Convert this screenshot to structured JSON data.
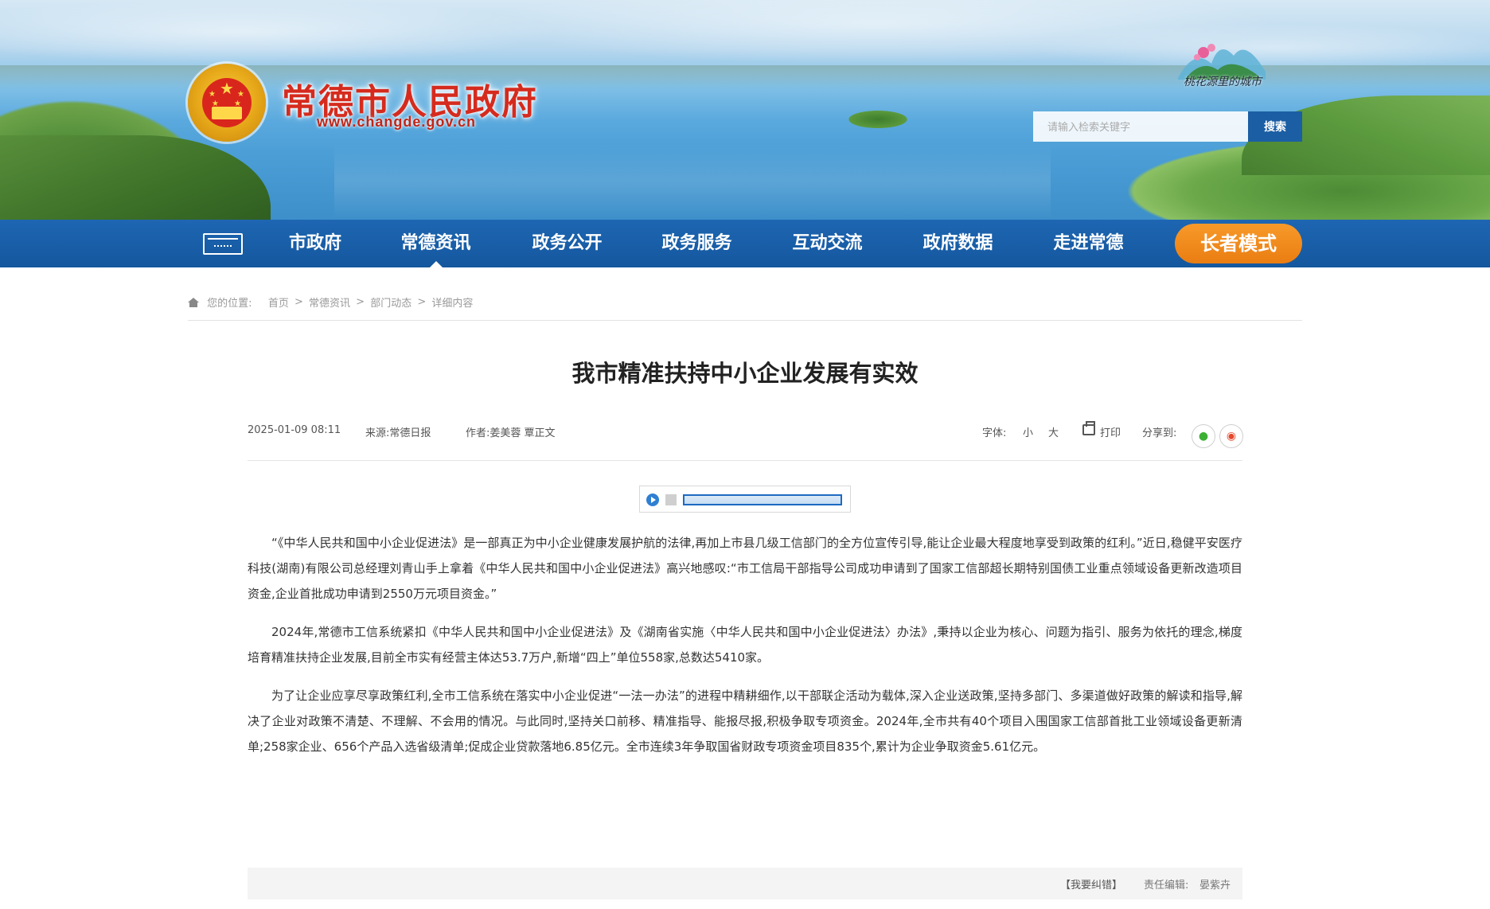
{
  "header": {
    "site_title": "常德市人民政府",
    "site_url": "www.changde.gov.cn",
    "city_slogan": "桃花源里的城市",
    "search": {
      "placeholder": "请输入检索关键字",
      "button_label": "搜索"
    }
  },
  "nav": {
    "items": [
      {
        "label": "市政府"
      },
      {
        "label": "常德资讯"
      },
      {
        "label": "政务公开"
      },
      {
        "label": "政务服务"
      },
      {
        "label": "互动交流"
      },
      {
        "label": "政府数据"
      },
      {
        "label": "走进常德"
      }
    ],
    "active_index": 1,
    "elder_mode_label": "长者模式"
  },
  "breadcrumb": {
    "prefix": "您的位置:",
    "items": [
      "首页",
      "常德资讯",
      "部门动态",
      "详细内容"
    ],
    "separator": ">"
  },
  "article": {
    "title": "我市精准扶持中小企业发展有实效",
    "date": "2025-01-09 08:11",
    "source": "来源:常德日报",
    "author": "作者:姜美蓉 覃正文",
    "font_label": "字体:",
    "font_small": "小",
    "font_large": "大",
    "print_label": "打印",
    "share_label": "分享到:",
    "paragraphs": [
      "“《中华人民共和国中小企业促进法》是一部真正为中小企业健康发展护航的法律,再加上市县几级工信部门的全方位宣传引导,能让企业最大程度地享受到政策的红利。”近日,稳健平安医疗科技(湖南)有限公司总经理刘青山手上拿着《中华人民共和国中小企业促进法》高兴地感叹:“市工信局干部指导公司成功申请到了国家工信部超长期特别国债工业重点领域设备更新改造项目资金,企业首批成功申请到2550万元项目资金。”",
      "2024年,常德市工信系统紧扣《中华人民共和国中小企业促进法》及《湖南省实施〈中华人民共和国中小企业促进法〉办法》,秉持以企业为核心、问题为指引、服务为依托的理念,梯度培育精准扶持企业发展,目前全市实有经营主体达53.7万户,新增“四上”单位558家,总数达5410家。",
      "为了让企业应享尽享政策红利,全市工信系统在落实中小企业促进“一法一办法”的进程中精耕细作,以干部联企活动为载体,深入企业送政策,坚持多部门、多渠道做好政策的解读和指导,解决了企业对政策不清楚、不理解、不会用的情况。与此同时,坚持关口前移、精准指导、能报尽报,积极争取专项资金。2024年,全市共有40个项目入围国家工信部首批工业领域设备更新清单;258家企业、656个产品入选省级清单;促成企业贷款落地6.85亿元。全市连续3年争取国省财政专项资金项目835个,累计为企业争取资金5.61亿元。"
    ]
  },
  "footer": {
    "correction_label": "【我要纠错】",
    "editor_label": "责任编辑:",
    "editor_name": "晏紫卉"
  },
  "colors": {
    "nav_bg": "#1a5fa8",
    "elder_btn": "#f08a1c",
    "title_red": "#d52b1e",
    "search_btn": "#1b5ea4"
  }
}
